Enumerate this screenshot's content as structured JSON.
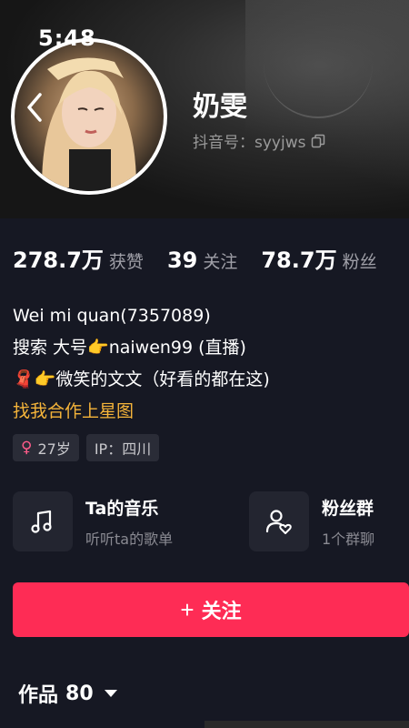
{
  "status_bar": {
    "time": "5:48"
  },
  "profile": {
    "name": "奶雯",
    "douyin_id": "抖音号：syyjws"
  },
  "stats": [
    {
      "value": "278.7万",
      "label": "获赞"
    },
    {
      "value": "39",
      "label": "关注"
    },
    {
      "value": "78.7万",
      "label": "粉丝"
    }
  ],
  "bio": {
    "line1": "Wei mi quan(7357089)",
    "line2": "搜索 大号👉naiwen99 (直播)",
    "line3": "🧣👉微笑的文文（好看的都在这)",
    "line4": "找我合作上星图"
  },
  "tags": {
    "gender_symbol": "♀",
    "age": "27岁",
    "ip": "IP：四川"
  },
  "cards": {
    "music": {
      "title": "Ta的音乐",
      "subtitle": "听听ta的歌单"
    },
    "fans": {
      "title": "粉丝群",
      "subtitle": "1个群聊"
    }
  },
  "follow_button": {
    "plus": "+",
    "label": "关注"
  },
  "works": {
    "label": "作品",
    "count": "80"
  },
  "colors": {
    "accent": "#fe2c55",
    "background": "#161823",
    "star": "#f5b43a"
  }
}
